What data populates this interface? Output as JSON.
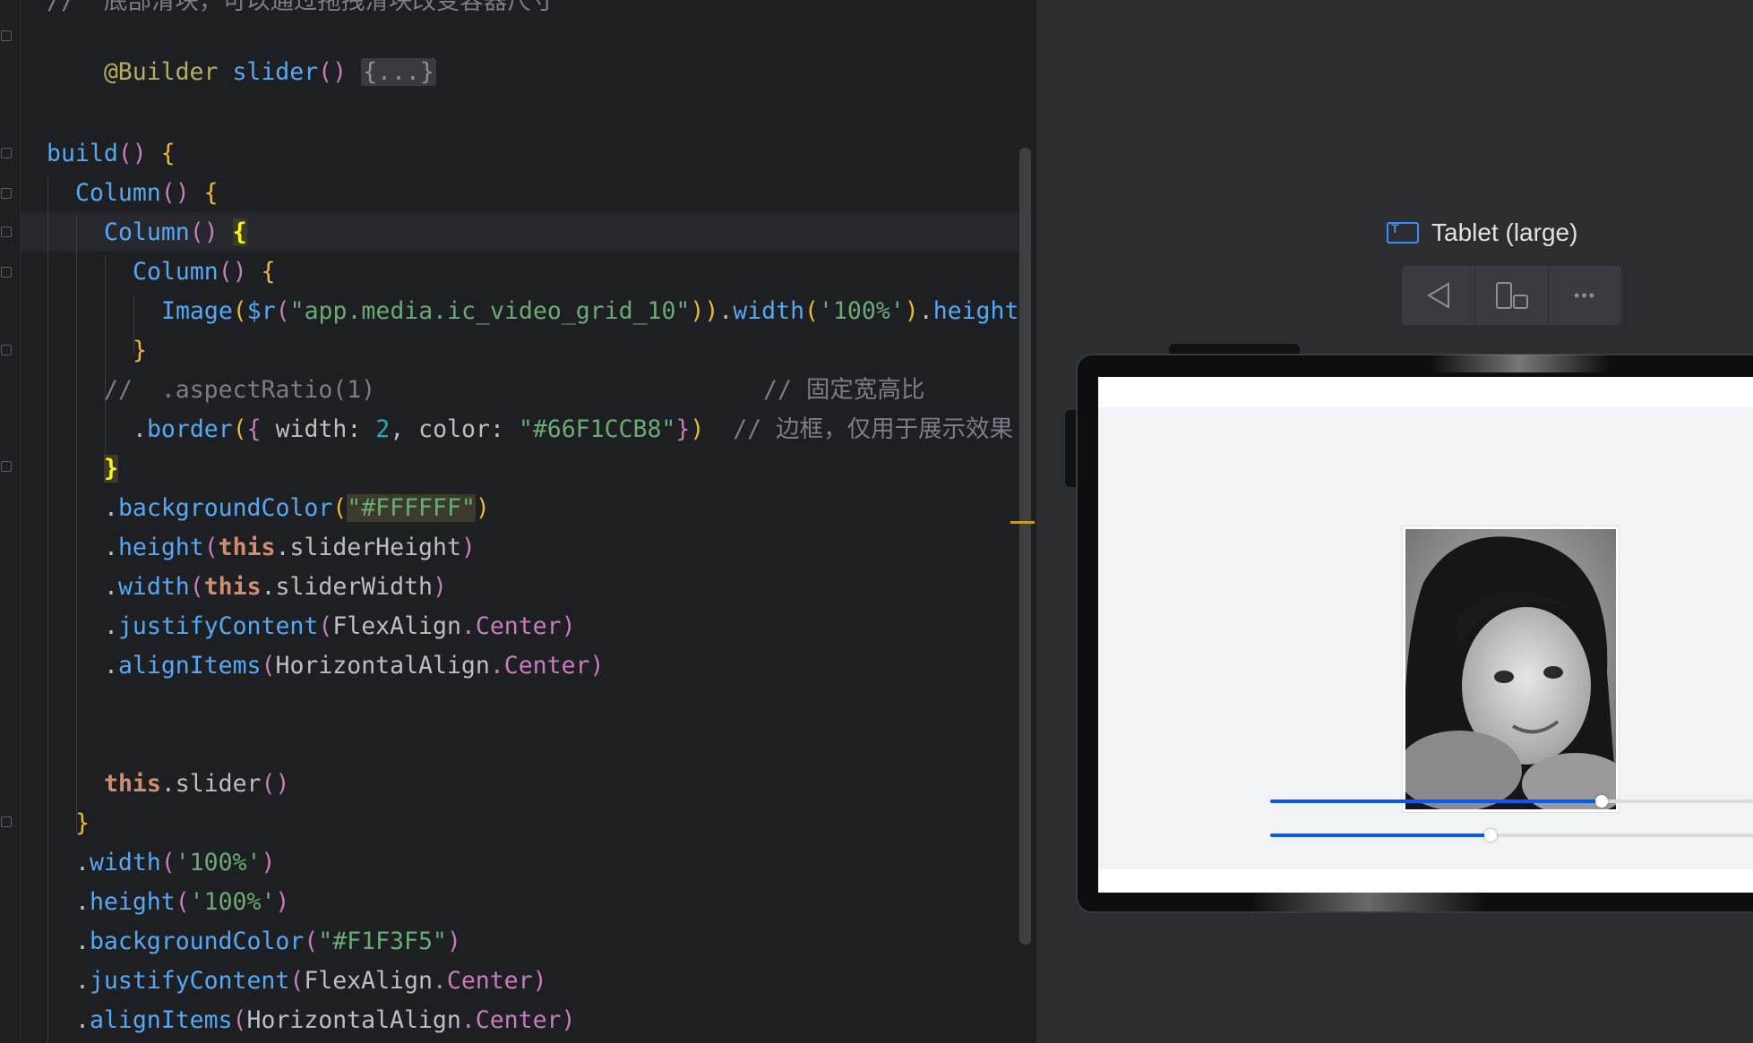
{
  "editor": {
    "line0": "//  底部滑块，可以通过拖拽滑块改变容器尺寸",
    "l1": {
      "dec": "@Builder",
      "fn": "slider",
      "p": "()",
      "fold": "{...}"
    },
    "l2": {
      "fn": "build",
      "p": "()",
      "b": "{"
    },
    "l3": {
      "fn": "Column",
      "p": "()",
      "b": "{"
    },
    "l4": {
      "fn": "Column",
      "p": "()",
      "b": "{"
    },
    "l5": {
      "fn": "Column",
      "p": "()",
      "b": "{"
    },
    "l6": {
      "fn": "Image",
      "p1": "(",
      "r": "$r",
      "p2": "(",
      "s": "\"app.media.ic_video_grid_10\"",
      "p3": "))",
      "dot1": ".",
      "w": "width",
      "p4": "(",
      "s2": "'100%'",
      "p5": ")",
      "dot2": ".",
      "h": "height",
      "p6": "("
    },
    "l7": {
      "b": "}"
    },
    "l8": {
      "cmt": "//  .aspectRatio(1)",
      "cmt2": "// 固定宽高比"
    },
    "l9": {
      "dot": ".",
      "fn": "border",
      "p1": "(",
      "b1": "{",
      "k1": " width: ",
      "n1": "2",
      "sep": ", ",
      "k2": "color: ",
      "s": "\"#66F1CCB8\"",
      "b2": "}",
      "p2": ")",
      "cmt": "// 边框，仅用于展示效果"
    },
    "l10": {
      "b": "}"
    },
    "l11": {
      "dot": ".",
      "fn": "backgroundColor",
      "p1": "(",
      "s": "\"#FFFFFF\"",
      "p2": ")"
    },
    "l12": {
      "dot": ".",
      "fn": "height",
      "p1": "(",
      "t": "this",
      "rest": ".sliderHeight",
      "p2": ")"
    },
    "l13": {
      "dot": ".",
      "fn": "width",
      "p1": "(",
      "t": "this",
      "rest": ".sliderWidth",
      "p2": ")"
    },
    "l14": {
      "dot": ".",
      "fn": "justifyContent",
      "p1": "(",
      "e": "FlexAlign",
      "rest": ".Center",
      "p2": ")"
    },
    "l15": {
      "dot": ".",
      "fn": "alignItems",
      "p1": "(",
      "e": "HorizontalAlign",
      "rest": ".Center",
      "p2": ")"
    },
    "l16": {
      "t": "this",
      "rest": ".slider",
      "p": "()"
    },
    "l17": {
      "b": "}"
    },
    "l18": {
      "dot": ".",
      "fn": "width",
      "p1": "(",
      "s": "'100%'",
      "p2": ")"
    },
    "l19": {
      "dot": ".",
      "fn": "height",
      "p1": "(",
      "s": "'100%'",
      "p2": ")"
    },
    "l20": {
      "dot": ".",
      "fn": "backgroundColor",
      "p1": "(",
      "s": "\"#F1F3F5\"",
      "p2": ")"
    },
    "l21": {
      "dot": ".",
      "fn": "justifyContent",
      "p1": "(",
      "e": "FlexAlign",
      "rest": ".Center",
      "p2": ")"
    },
    "l22": {
      "dot": ".",
      "fn": "alignItems",
      "p1": "(",
      "e": "HorizontalAlign",
      "rest": ".Center",
      "p2": ")"
    }
  },
  "preview": {
    "device_label": "Tablet (large)",
    "device_icon": "tablet-icon",
    "toolbar": {
      "back_icon": "◁",
      "rotate_icon": "▯",
      "more_icon": "•••"
    },
    "sliders": [
      {
        "value": 0.685
      },
      {
        "value": 0.455
      }
    ]
  }
}
